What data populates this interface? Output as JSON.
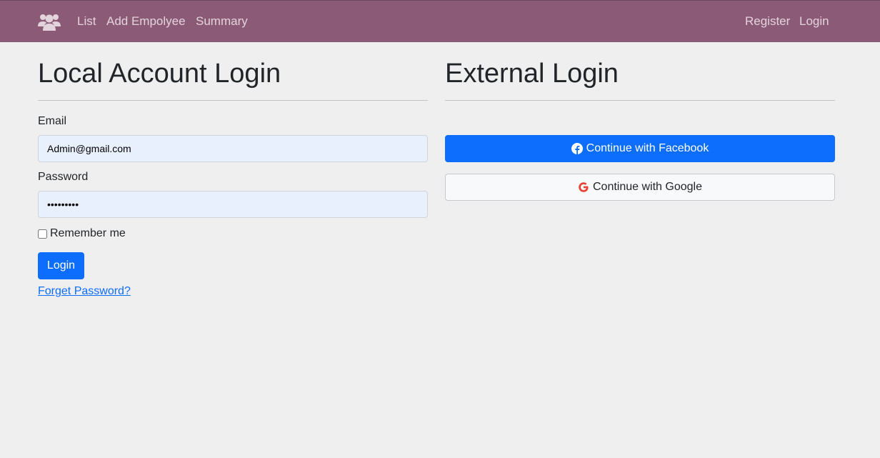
{
  "navbar": {
    "brand_icon": "users-icon",
    "links": [
      "List",
      "Add Empolyee",
      "Summary"
    ],
    "right_links": [
      "Register",
      "Login"
    ],
    "background_color": "#8b5a77"
  },
  "local_login": {
    "title": "Local Account Login",
    "email_label": "Email",
    "email_value": "Admin@gmail.com",
    "password_label": "Password",
    "password_value": "•••••••••",
    "remember_label": "Remember me",
    "remember_checked": false,
    "login_button": "Login",
    "forgot_link": "Forget Password?"
  },
  "external_login": {
    "title": "External Login",
    "facebook_button": "Continue with Facebook",
    "facebook_icon": "facebook-icon",
    "google_button": "Continue with Google",
    "google_icon": "google-icon",
    "facebook_color": "#0d6efd"
  }
}
